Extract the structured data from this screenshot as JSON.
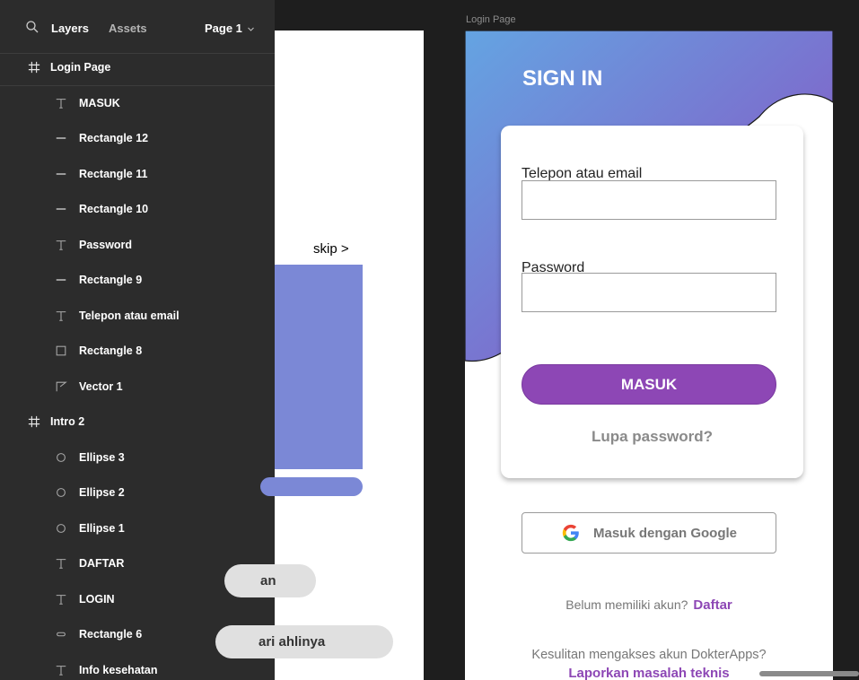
{
  "panel": {
    "tabs": {
      "layers": "Layers",
      "assets": "Assets"
    },
    "page_selector": "Page 1",
    "layers": [
      {
        "label": "Login Page",
        "kind": "frame",
        "icon": "frame-icon"
      },
      {
        "label": "MASUK",
        "kind": "child",
        "icon": "text-icon"
      },
      {
        "label": "Rectangle 12",
        "kind": "child",
        "icon": "line-icon"
      },
      {
        "label": "Rectangle 11",
        "kind": "child",
        "icon": "line-icon"
      },
      {
        "label": "Rectangle 10",
        "kind": "child",
        "icon": "line-icon"
      },
      {
        "label": "Password",
        "kind": "child",
        "icon": "text-icon"
      },
      {
        "label": "Rectangle 9",
        "kind": "child",
        "icon": "line-icon"
      },
      {
        "label": "Telepon atau email",
        "kind": "child",
        "icon": "text-icon"
      },
      {
        "label": "Rectangle 8",
        "kind": "child",
        "icon": "rectangle-icon"
      },
      {
        "label": "Vector 1",
        "kind": "child",
        "icon": "vector-icon"
      },
      {
        "label": "Intro 2",
        "kind": "frame",
        "icon": "frame-icon"
      },
      {
        "label": "Ellipse 3",
        "kind": "child",
        "icon": "ellipse-icon"
      },
      {
        "label": "Ellipse 2",
        "kind": "child",
        "icon": "ellipse-icon"
      },
      {
        "label": "Ellipse 1",
        "kind": "child",
        "icon": "ellipse-icon"
      },
      {
        "label": "DAFTAR",
        "kind": "child",
        "icon": "text-icon"
      },
      {
        "label": "LOGIN",
        "kind": "child",
        "icon": "text-icon"
      },
      {
        "label": "Rectangle 6",
        "kind": "child",
        "icon": "rounded-rect-icon"
      },
      {
        "label": "Info kesehatan",
        "kind": "child",
        "icon": "text-icon"
      }
    ]
  },
  "canvas": {
    "intro": {
      "skip": "skip >",
      "pill_1": "an",
      "pill_2": "ari ahlinya"
    },
    "login": {
      "frame_label": "Login Page",
      "title": "SIGN IN",
      "email_label": "Telepon atau email",
      "email_value": "",
      "password_label": "Password",
      "password_value": "",
      "submit": "MASUK",
      "forgot": "Lupa password?",
      "google_button": "Masuk dengan Google",
      "signup_prompt": "Belum memiliki akun?",
      "signup_link": "Daftar",
      "help_text": "Kesulitan mengakses akun DokterApps?",
      "report_link": "Laporkan masalah teknis"
    }
  },
  "colors": {
    "panel_bg": "#2c2c2c",
    "canvas_bg": "#1e1e1e",
    "accent_purple": "#8d47b5",
    "gradient_start": "#6aa0e0",
    "gradient_end": "#8e4ab8",
    "intro_blue": "#7b88d6"
  }
}
